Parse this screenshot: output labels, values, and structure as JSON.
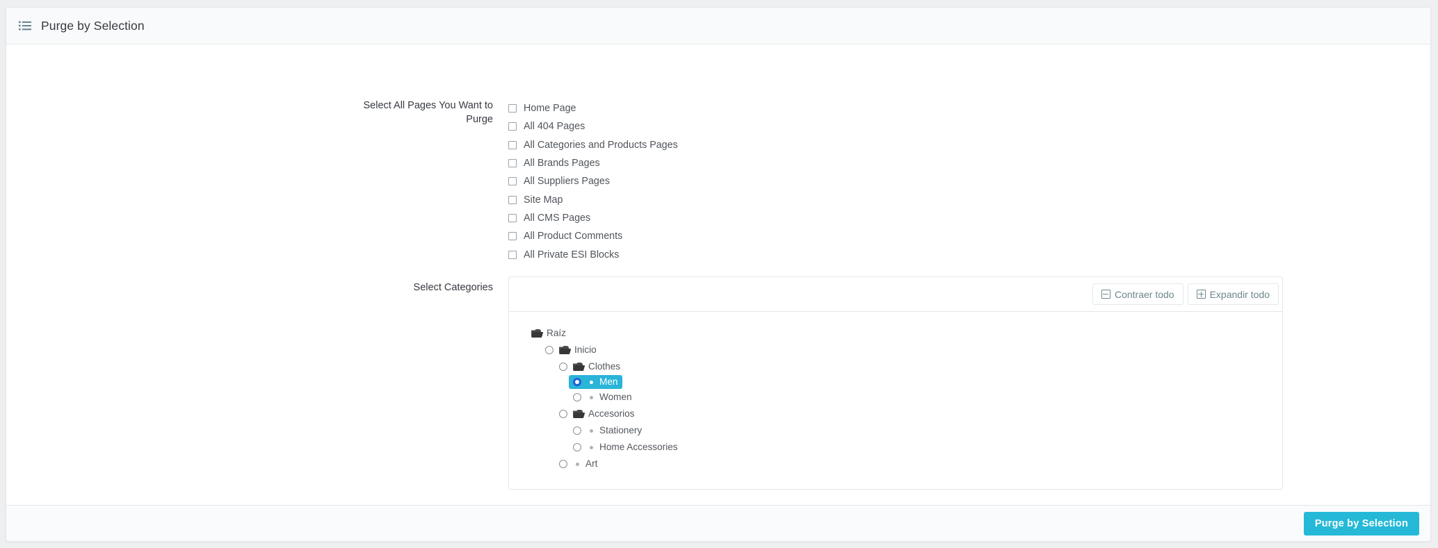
{
  "header": {
    "icon": "list-ul-icon",
    "title": "Purge by Selection"
  },
  "form": {
    "pages_label": "Select All Pages You Want to Purge",
    "categories_label": "Select Categories",
    "page_checkboxes": [
      {
        "label": "Home Page",
        "checked": false
      },
      {
        "label": "All 404 Pages",
        "checked": false
      },
      {
        "label": "All Categories and Products Pages",
        "checked": false
      },
      {
        "label": "All Brands Pages",
        "checked": false
      },
      {
        "label": "All Suppliers Pages",
        "checked": false
      },
      {
        "label": "Site Map",
        "checked": false
      },
      {
        "label": "All CMS Pages",
        "checked": false
      },
      {
        "label": "All Product Comments",
        "checked": false
      },
      {
        "label": "All Private ESI Blocks",
        "checked": false
      }
    ]
  },
  "tree": {
    "toolbar": {
      "collapse_all_label": "Contraer todo",
      "collapse_all_icon": "minus-square-icon",
      "expand_all_label": "Expandir todo",
      "expand_all_icon": "plus-square-icon"
    },
    "nodes": [
      {
        "label": "Raíz",
        "depth": 0,
        "icon": "folder-icon",
        "radio": false,
        "selected": false
      },
      {
        "label": "Inicio",
        "depth": 1,
        "icon": "folder-icon",
        "radio": true,
        "selected": false
      },
      {
        "label": "Clothes",
        "depth": 2,
        "icon": "folder-icon",
        "radio": true,
        "selected": false
      },
      {
        "label": "Men",
        "depth": 3,
        "icon": "dot-icon",
        "radio": true,
        "selected": true
      },
      {
        "label": "Women",
        "depth": 3,
        "icon": "dot-icon",
        "radio": true,
        "selected": false
      },
      {
        "label": "Accesorios",
        "depth": 2,
        "icon": "folder-icon",
        "radio": true,
        "selected": false
      },
      {
        "label": "Stationery",
        "depth": 3,
        "icon": "dot-icon",
        "radio": true,
        "selected": false
      },
      {
        "label": "Home Accessories",
        "depth": 3,
        "icon": "dot-icon",
        "radio": true,
        "selected": false
      },
      {
        "label": "Art",
        "depth": 2,
        "icon": "dot-icon",
        "radio": true,
        "selected": false
      }
    ]
  },
  "footer": {
    "submit_label": "Purge by Selection"
  },
  "colors": {
    "accent": "#25b9d7",
    "selected_node_bg": "#2ab4d8",
    "selected_radio_ring": "#1f5fd6",
    "panel_border": "#e3e8ec",
    "text": "#363a41",
    "muted_text": "#50555b",
    "button_text": "#6c868e"
  }
}
